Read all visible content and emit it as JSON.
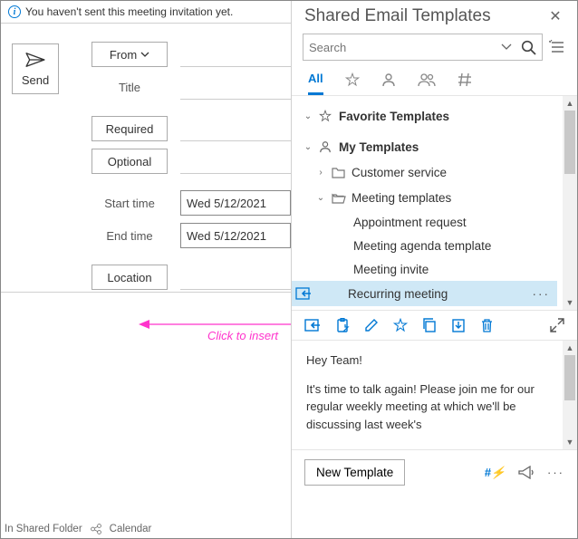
{
  "info_message": "You haven't sent this meeting invitation yet.",
  "compose": {
    "send": "Send",
    "from": "From",
    "title_label": "Title",
    "required_btn": "Required",
    "optional_btn": "Optional",
    "start_label": "Start time",
    "end_label": "End time",
    "start_value": "Wed 5/12/2021",
    "end_value": "Wed 5/12/2021",
    "location_btn": "Location"
  },
  "annotation": "Click to insert",
  "status": {
    "folder": "In Shared Folder",
    "context": "Calendar"
  },
  "panel": {
    "title": "Shared Email Templates",
    "search_placeholder": "Search",
    "tabs": {
      "all": "All"
    },
    "tree": {
      "favorites": "Favorite Templates",
      "my": "My Templates",
      "customer_service": "Customer service",
      "meeting_templates": "Meeting templates",
      "items": {
        "appt": "Appointment request",
        "agenda": "Meeting agenda template",
        "invite": "Meeting invite",
        "recurring": "Recurring meeting"
      }
    },
    "preview": {
      "greeting": "Hey Team!",
      "body": "It's time to talk again! Please join me for our regular weekly meeting at which we'll be discussing last week's"
    },
    "new_template": "New Template"
  }
}
